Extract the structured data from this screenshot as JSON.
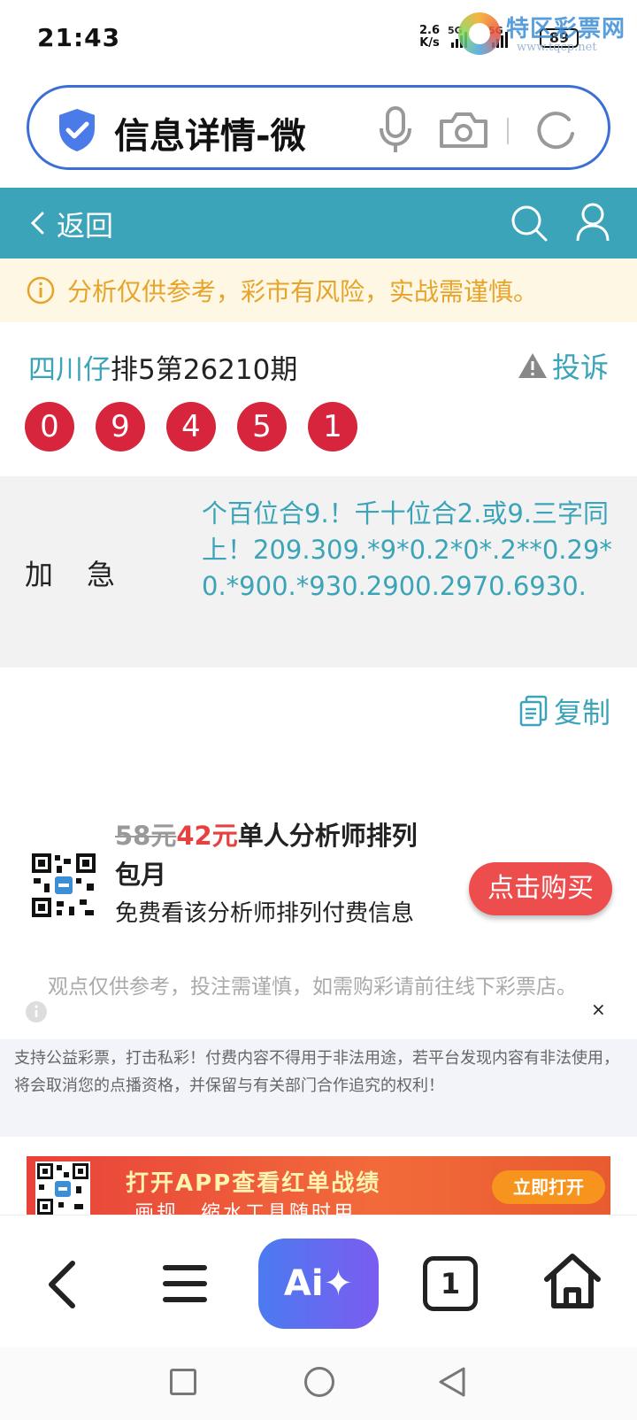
{
  "status_bar": {
    "time": "21:43",
    "net_speed_value": "2.6",
    "net_speed_unit": "K/s",
    "network_1": "5G",
    "network_2": "5G",
    "battery": "89"
  },
  "watermark": {
    "name": "特区彩票网",
    "url": "www.tqcp.net"
  },
  "address_bar": {
    "text": "信息详情-微"
  },
  "nav": {
    "back_label": "返回"
  },
  "warning": {
    "text": "分析仅供参考，彩市有风险，实战需谨慎。"
  },
  "issue": {
    "name": "四川仔",
    "rest": "排5第26210期",
    "complain_label": "投诉"
  },
  "balls": [
    "0",
    "9",
    "4",
    "5",
    "1"
  ],
  "content": {
    "label": "加急",
    "text": "个百位合9.！千十位合2.或9.三字同上！209.309.*9*0.2*0*.2**0.29*0.*900.*930.2900.2970.6930."
  },
  "copy_label": "复制",
  "offer": {
    "old_price": "58元",
    "new_price": "42元",
    "title": "单人分析师排列包月",
    "desc": "免费看该分析师排列付费信息",
    "buy_label": "点击购买"
  },
  "disclaimer": {
    "text": "观点仅供参考，投注需谨慎，如需购彩请前往线下彩票店。",
    "close": "×",
    "notice": "支持公益彩票，打击私彩！付费内容不得用于非法用途，若平台发现内容有非法使用，将会取消您的点播资格，并保留与有关部门合作追究的权利！"
  },
  "banner": {
    "title": "打开APP查看红单战绩",
    "subtitle": "画规、缩水工具随时用",
    "open_label": "立即打开"
  },
  "bottom_bar": {
    "ai_label": "Ai✦",
    "tab_count": "1"
  },
  "colors": {
    "primary": "#3ba4b8",
    "ball": "#d8253e",
    "buy": "#ee4d4d",
    "warning_text": "#e6a42a"
  }
}
